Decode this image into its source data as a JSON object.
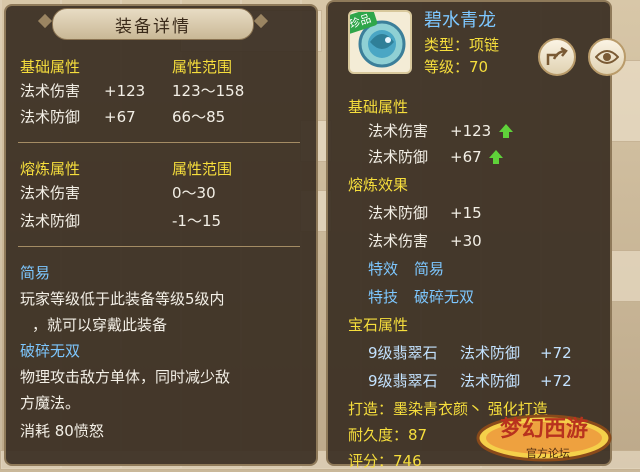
{
  "left": {
    "title": "装备详情",
    "basic_header": "基础属性",
    "range_header": "属性范围",
    "basic_rows": [
      {
        "name": "法术伤害",
        "value": "+123",
        "range": "123～158"
      },
      {
        "name": "法术防御",
        "value": "+67",
        "range": "66～85"
      }
    ],
    "refine_header": "熔炼属性",
    "refine_range_header": "属性范围",
    "refine_rows": [
      {
        "name": "法术伤害",
        "range": "0～30"
      },
      {
        "name": "法术防御",
        "range": "-1～15"
      }
    ],
    "easy_title": "简易",
    "easy_desc_1": "玩家等级低于此装备等级5级内",
    "easy_desc_2": "，就可以穿戴此装备",
    "skill_title": "破碎无双",
    "skill_desc_1": "物理攻击敌方单体，同时减少敌",
    "skill_desc_2": "方魔法。",
    "cost": "消耗  80愤怒"
  },
  "right": {
    "item_name": "碧水青龙",
    "item_tag": "珍品",
    "type_line": "类型：项链",
    "level_line": "等级：70",
    "basic_header": "基础属性",
    "basic_rows": [
      {
        "name": "法术伤害",
        "value": "+123"
      },
      {
        "name": "法术防御",
        "value": "+67"
      }
    ],
    "refine_header": "熔炼效果",
    "refine_rows": [
      {
        "name": "法术防御",
        "value": "+15"
      },
      {
        "name": "法术伤害",
        "value": "+30"
      }
    ],
    "effect_label": "特效",
    "effect_value": "简易",
    "skill_label": "特技",
    "skill_value": "破碎无双",
    "gem_header": "宝石属性",
    "gem_rows": [
      {
        "gem": "9级翡翠石",
        "attr": "法术防御",
        "value": "+72"
      },
      {
        "gem": "9级翡翠石",
        "attr": "法术防御",
        "value": "+72"
      }
    ],
    "forge_line": "打造：墨染青衣颜丶   强化打造",
    "durability": "耐久度：87",
    "score": "评分：746"
  },
  "logo": {
    "main": "梦幻西游",
    "sub": "官方论坛"
  },
  "icons": {
    "share": "share-icon",
    "eye": "eye-icon",
    "arrow": "up-arrow-icon"
  },
  "colors": {
    "gold": "#f6de3c",
    "cyan": "#7dc7ff",
    "green": "#5fd23a",
    "panel": "#3a2e22"
  }
}
